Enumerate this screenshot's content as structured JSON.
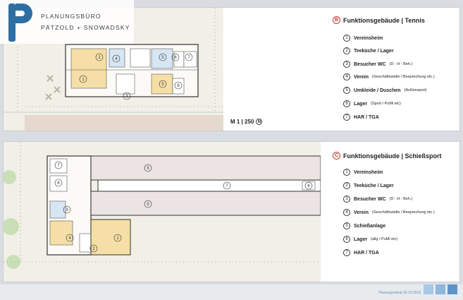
{
  "logo": {
    "line1": "PLANUNGSBÜRO",
    "line2": "PÄTZOLD + SNOWADSKY",
    "color": "#2d6fa3"
  },
  "section_b": {
    "letter": "B",
    "title": "Funktionsgebäude  | Tennis",
    "scale_text": "M 1 | 250",
    "north_glyph": "N",
    "items": [
      {
        "num": "1",
        "label": "Vereinsheim",
        "note": ""
      },
      {
        "num": "2",
        "label": "Teeküche / Lager",
        "note": ""
      },
      {
        "num": "3",
        "label": "Besucher WC",
        "note": "(D - H - Beh.)"
      },
      {
        "num": "4",
        "label": "Verein",
        "note": "(Geschäftsstelle / Besprechung etc.)"
      },
      {
        "num": "5",
        "label": "Umkleide / Duschen",
        "note": "(Außensport)"
      },
      {
        "num": "6",
        "label": "Lager",
        "note": "(Sport / PuMi etc)"
      },
      {
        "num": "7",
        "label": "HAR / TGA",
        "note": ""
      }
    ],
    "plan_labels": [
      "1",
      "2",
      "3",
      "4",
      "5",
      "5",
      "6",
      "6",
      "7"
    ]
  },
  "section_c": {
    "letter": "C",
    "title": "Funktionsgebäude  | Schießsport",
    "items": [
      {
        "num": "1",
        "label": "Vereinsheim",
        "note": ""
      },
      {
        "num": "2",
        "label": "Teeküche / Lager",
        "note": ""
      },
      {
        "num": "3",
        "label": "Besucher WC",
        "note": "(D - H - Beh.)"
      },
      {
        "num": "4",
        "label": "Verein",
        "note": "(Geschäftsstelle / Besprechung etc.)"
      },
      {
        "num": "5",
        "label": "Schießanlage",
        "note": ""
      },
      {
        "num": "6",
        "label": "Lager",
        "note": "(allg / PuMi etc)"
      },
      {
        "num": "7",
        "label": "HAR / TGA",
        "note": ""
      }
    ],
    "plan_labels": [
      "7",
      "6",
      "5",
      "7",
      "6",
      "5",
      "3",
      "4",
      "2",
      "1"
    ]
  },
  "footer": {
    "date_text": "Planungsstand 30.10.2018",
    "accent": "#8fb6dd"
  }
}
